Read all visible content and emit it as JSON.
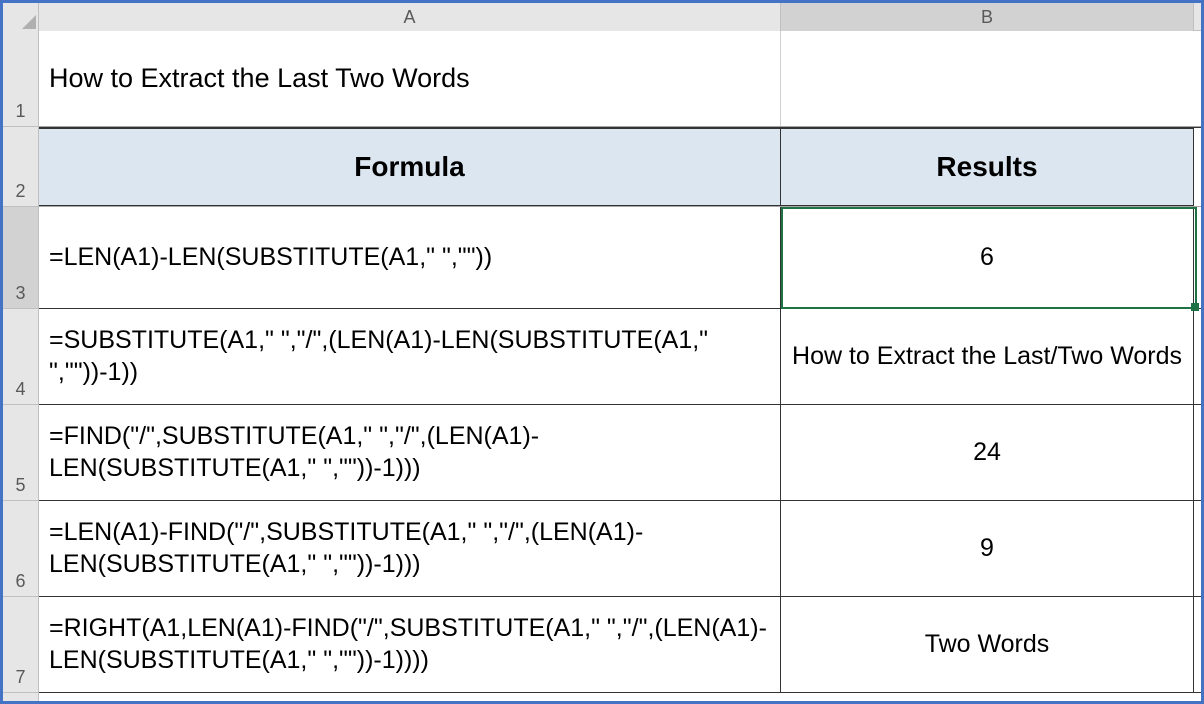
{
  "columns": {
    "A": "A",
    "B": "B"
  },
  "row_numbers": [
    "1",
    "2",
    "3",
    "4",
    "5",
    "6",
    "7"
  ],
  "cells": {
    "A1": "How to Extract the Last Two Words",
    "A2": "Formula",
    "B2": "Results",
    "A3": "=LEN(A1)-LEN(SUBSTITUTE(A1,\" \",\"\"))",
    "B3": "6",
    "A4": "=SUBSTITUTE(A1,\" \",\"/\",(LEN(A1)-LEN(SUBSTITUTE(A1,\" \",\"\"))-1))",
    "B4": "How to Extract the Last/Two Words",
    "A5": "=FIND(\"/\",SUBSTITUTE(A1,\" \",\"/\",(LEN(A1)-LEN(SUBSTITUTE(A1,\" \",\"\"))-1)))",
    "B5": "24",
    "A6": "=LEN(A1)-FIND(\"/\",SUBSTITUTE(A1,\" \",\"/\",(LEN(A1)-LEN(SUBSTITUTE(A1,\" \",\"\"))-1)))",
    "B6": "9",
    "A7": "=RIGHT(A1,LEN(A1)-FIND(\"/\",SUBSTITUTE(A1,\" \",\"/\",(LEN(A1)-LEN(SUBSTITUTE(A1,\" \",\"\"))-1))))",
    "B7": "Two Words"
  },
  "active_cell": "B3"
}
